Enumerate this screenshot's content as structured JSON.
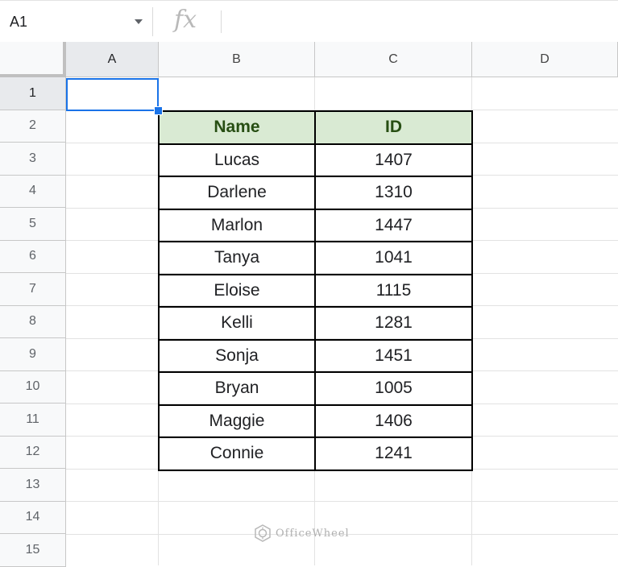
{
  "formula_bar": {
    "name_box": "A1",
    "fx_label": "fx",
    "formula": ""
  },
  "columns": [
    "A",
    "B",
    "C",
    "D"
  ],
  "rows": [
    "1",
    "2",
    "3",
    "4",
    "5",
    "6",
    "7",
    "8",
    "9",
    "10",
    "11",
    "12",
    "13",
    "14",
    "15"
  ],
  "selected_cell": "A1",
  "table": {
    "headers": [
      "Name",
      "ID"
    ],
    "rows": [
      [
        "Lucas",
        "1407"
      ],
      [
        "Darlene",
        "1310"
      ],
      [
        "Marlon",
        "1447"
      ],
      [
        "Tanya",
        "1041"
      ],
      [
        "Eloise",
        "1115"
      ],
      [
        "Kelli",
        "1281"
      ],
      [
        "Sonja",
        "1451"
      ],
      [
        "Bryan",
        "1005"
      ],
      [
        "Maggie",
        "1406"
      ],
      [
        "Connie",
        "1241"
      ]
    ],
    "header_bg": "#d9ead3",
    "header_color": "#274e13"
  },
  "watermark": "OfficeWheel",
  "colors": {
    "selection": "#1a73e8"
  }
}
